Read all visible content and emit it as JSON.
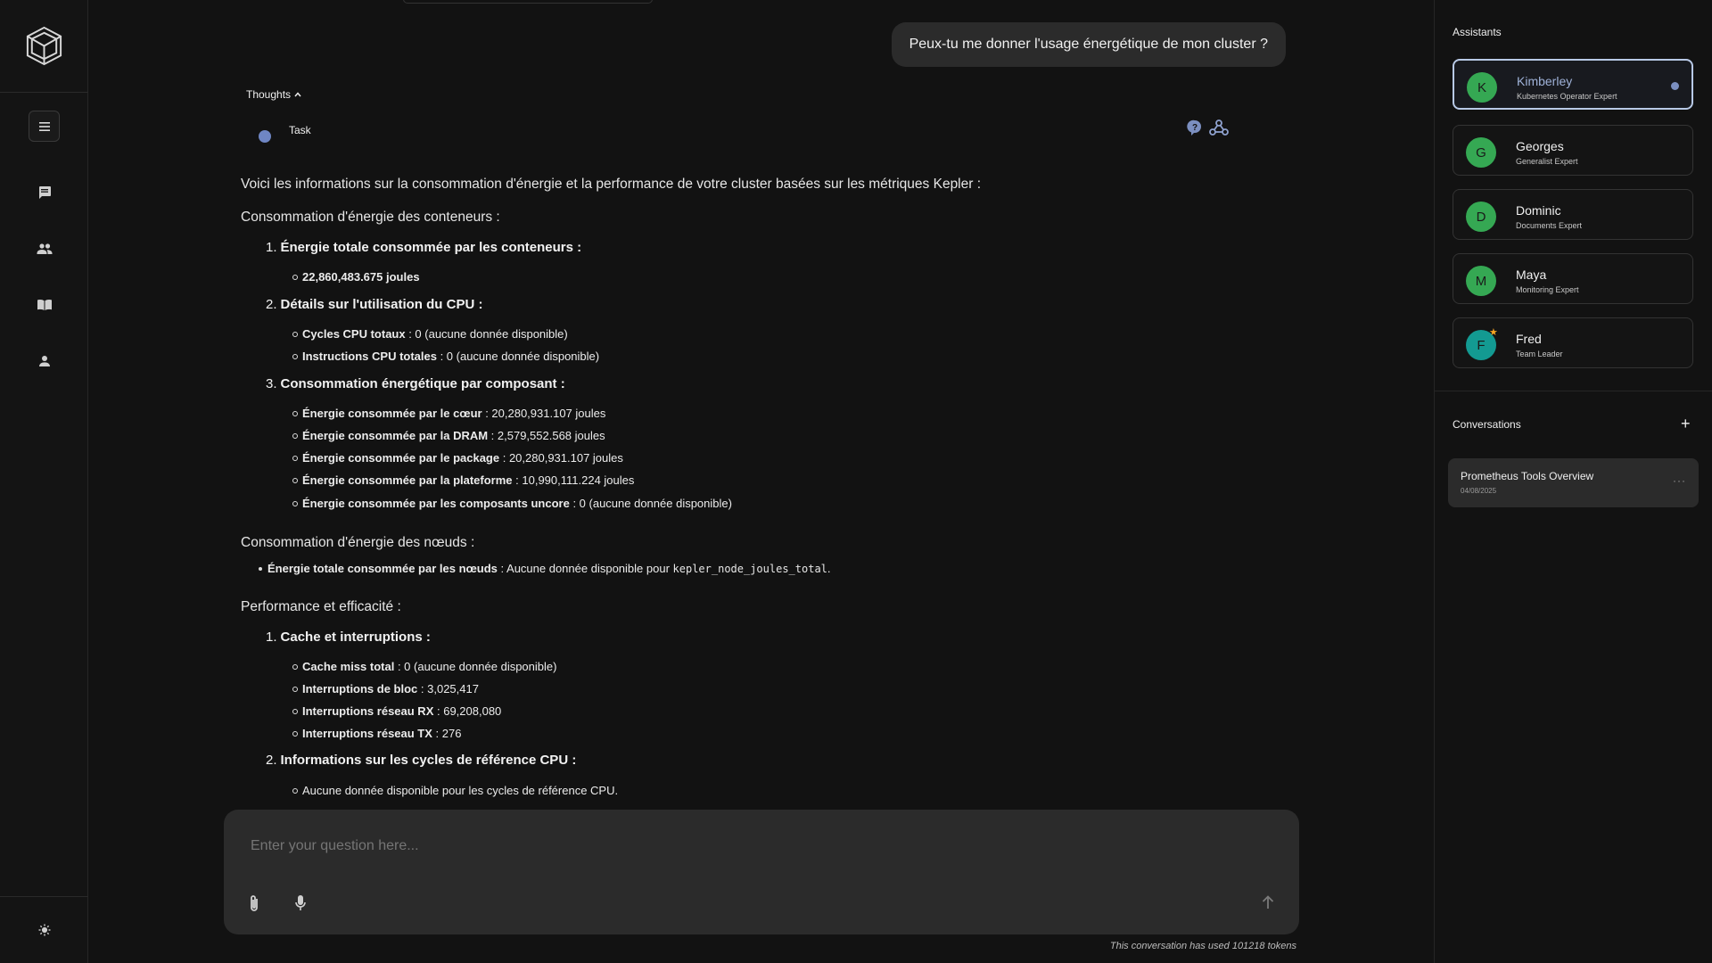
{
  "user_message": "Peux-tu me donner l'usage énergétique de mon cluster ?",
  "thoughts_label": "Thoughts",
  "task_label": "Task",
  "answer": {
    "intro": "Voici les informations sur la consommation d'énergie et la performance de votre cluster basées sur les métriques Kepler :",
    "s1_title": "Consommation d'énergie des conteneurs :",
    "s1_h1": "Énergie totale consommée par les conteneurs :",
    "s1_h1_i1": "22,860,483.675 joules",
    "s1_h2": "Détails sur l'utilisation du CPU :",
    "s1_h2_i1_b": "Cycles CPU totaux",
    "s1_h2_i1_t": " : 0 (aucune donnée disponible)",
    "s1_h2_i2_b": "Instructions CPU totales",
    "s1_h2_i2_t": " : 0 (aucune donnée disponible)",
    "s1_h3": "Consommation énergétique par composant :",
    "s1_h3_i1_b": "Énergie consommée par le cœur",
    "s1_h3_i1_t": " : 20,280,931.107 joules",
    "s1_h3_i2_b": "Énergie consommée par la DRAM",
    "s1_h3_i2_t": " : 2,579,552.568 joules",
    "s1_h3_i3_b": "Énergie consommée par le package",
    "s1_h3_i3_t": " : 20,280,931.107 joules",
    "s1_h3_i4_b": "Énergie consommée par la plateforme",
    "s1_h3_i4_t": " : 10,990,111.224 joules",
    "s1_h3_i5_b": "Énergie consommée par les composants uncore",
    "s1_h3_i5_t": " : 0 (aucune donnée disponible)",
    "s2_title": "Consommation d'énergie des nœuds :",
    "s2_i1_b": "Énergie totale consommée par les nœuds",
    "s2_i1_t": " : Aucune donnée disponible pour ",
    "s2_i1_code": "kepler_node_joules_total",
    "s2_i1_end": ".",
    "s3_title": "Performance et efficacité :",
    "s3_h1": "Cache et interruptions :",
    "s3_h1_i1_b": "Cache miss total",
    "s3_h1_i1_t": " : 0 (aucune donnée disponible)",
    "s3_h1_i2_b": "Interruptions de bloc",
    "s3_h1_i2_t": " : 3,025,417",
    "s3_h1_i3_b": "Interruptions réseau RX",
    "s3_h1_i3_t": " : 69,208,080",
    "s3_h1_i4_b": "Interruptions réseau TX",
    "s3_h1_i4_t": " : 276",
    "s3_h2": "Informations sur les cycles de référence CPU :",
    "s3_h2_i1": "Aucune donnée disponible pour les cycles de référence CPU."
  },
  "composer": {
    "placeholder": "Enter your question here...",
    "token_usage": "This conversation has used 101218 tokens"
  },
  "right_panel": {
    "assistants_title": "Assistants",
    "assistants": [
      {
        "initial": "K",
        "name": "Kimberley",
        "role": "Kubernetes Operator Expert"
      },
      {
        "initial": "G",
        "name": "Georges",
        "role": "Generalist Expert"
      },
      {
        "initial": "D",
        "name": "Dominic",
        "role": "Documents Expert"
      },
      {
        "initial": "M",
        "name": "Maya",
        "role": "Monitoring Expert"
      },
      {
        "initial": "F",
        "name": "Fred",
        "role": "Team Leader"
      }
    ],
    "conversations_title": "Conversations",
    "conversations": [
      {
        "title": "Prometheus Tools Overview",
        "date": "04/08/2025"
      }
    ]
  },
  "colors": {
    "accent": "#7b8fc0",
    "avatar_green": "#35a853",
    "avatar_teal": "#139a92",
    "star": "#f5a623"
  }
}
